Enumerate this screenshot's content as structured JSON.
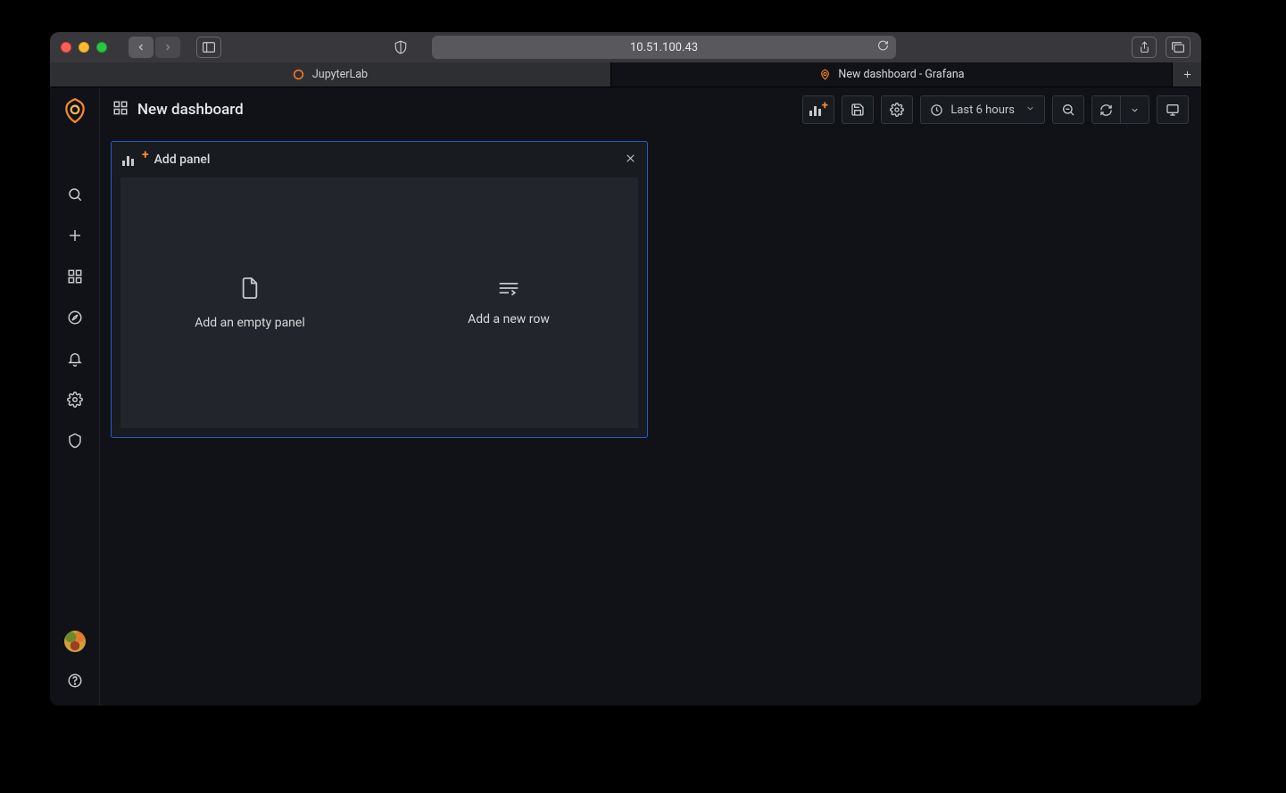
{
  "browser": {
    "address": "10.51.100.43",
    "tabs": [
      {
        "label": "JupyterLab",
        "active": false,
        "icon": "jupyter"
      },
      {
        "label": "New dashboard - Grafana",
        "active": true,
        "icon": "grafana"
      }
    ]
  },
  "grafana": {
    "breadcrumb": "New dashboard",
    "timepicker_label": "Last 6 hours",
    "add_panel": {
      "title": "Add panel",
      "empty_panel_label": "Add an empty panel",
      "new_row_label": "Add a new row"
    },
    "sidebar_icons": [
      "search",
      "create",
      "dashboards",
      "explore",
      "alerting",
      "configuration",
      "server-admin"
    ]
  }
}
